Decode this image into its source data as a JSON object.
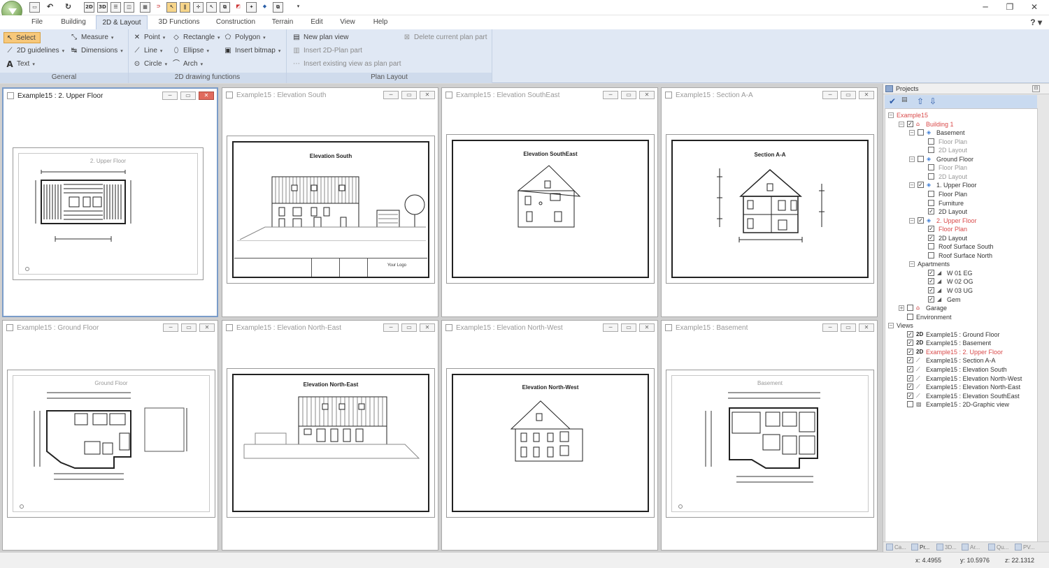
{
  "titlebar": {
    "quick_access": [
      "new-doc-icon",
      "undo-icon",
      "redo-icon",
      "view-2d-icon",
      "view-3d-icon",
      "split-horizontal-icon",
      "split-vertical-icon",
      "grid-icon",
      "magnet-icon",
      "cursor-select-icon",
      "parallel-icon",
      "snap-icon",
      "pointer-icon",
      "maximize-views-icon",
      "export-icon",
      "render-icon",
      "brush-icon",
      "copy-icon"
    ],
    "qat_labels": {
      "view_2d": "2D",
      "view_3d": "3D"
    },
    "window_controls": {
      "minimize": "─",
      "restore": "❐",
      "close": "✕"
    }
  },
  "menu": {
    "items": [
      "File",
      "Building",
      "2D & Layout",
      "3D Functions",
      "Construction",
      "Terrain",
      "Edit",
      "View",
      "Help"
    ],
    "active": "2D & Layout",
    "help": "?"
  },
  "ribbon": {
    "general": {
      "label": "General",
      "select": "Select",
      "measure": "Measure",
      "guidelines": "2D guidelines",
      "dimensions": "Dimensions",
      "text": "Text"
    },
    "drawing": {
      "label": "2D drawing functions",
      "point": "Point",
      "rectangle": "Rectangle",
      "polygon": "Polygon",
      "line": "Line",
      "ellipse": "Ellipse",
      "insert_bitmap": "Insert bitmap",
      "circle": "Circle",
      "arch": "Arch"
    },
    "layout": {
      "label": "Plan Layout",
      "new_plan_view": "New plan view",
      "delete_plan_part": "Delete current plan part",
      "insert_2d": "Insert 2D-Plan part",
      "insert_existing": "Insert existing view as plan part"
    }
  },
  "views": [
    {
      "title": "Example15 : 2. Upper Floor",
      "drawing_title": "2. Upper Floor",
      "active": true
    },
    {
      "title": "Example15 : Elevation South",
      "drawing_title": "Elevation South",
      "title_block": "Your Logo"
    },
    {
      "title": "Example15 : Elevation SouthEast",
      "drawing_title": "Elevation SouthEast"
    },
    {
      "title": "Example15 : Section A-A",
      "drawing_title": "Section A-A"
    },
    {
      "title": "Example15 : Ground Floor",
      "drawing_title": "Ground Floor"
    },
    {
      "title": "Example15 : Elevation North-East",
      "drawing_title": "Elevation North-East"
    },
    {
      "title": "Example15 : Elevation North-West",
      "drawing_title": "Elevation North-West"
    },
    {
      "title": "Example15 : Basement",
      "drawing_title": "Basement"
    }
  ],
  "projects": {
    "title": "Projects",
    "tree": [
      {
        "label": "Example15",
        "level": 0,
        "state": "open",
        "color": "red"
      },
      {
        "label": "Building 1",
        "level": 1,
        "state": "open",
        "checked": true,
        "color": "red",
        "icon": "building-icon"
      },
      {
        "label": "Basement",
        "level": 2,
        "state": "open",
        "checked": false,
        "icon": "floor-icon"
      },
      {
        "label": "Floor Plan",
        "level": 3,
        "checked": false,
        "color": "grey"
      },
      {
        "label": "2D Layout",
        "level": 3,
        "checked": false,
        "color": "grey"
      },
      {
        "label": "Ground Floor",
        "level": 2,
        "state": "open",
        "checked": false,
        "icon": "floor-icon"
      },
      {
        "label": "Floor Plan",
        "level": 3,
        "checked": false,
        "color": "grey"
      },
      {
        "label": "2D Layout",
        "level": 3,
        "checked": false,
        "color": "grey"
      },
      {
        "label": "1. Upper Floor",
        "level": 2,
        "state": "open",
        "checked": true,
        "icon": "floor-icon"
      },
      {
        "label": "Floor Plan",
        "level": 3,
        "checked": false
      },
      {
        "label": "Furniture",
        "level": 3,
        "checked": false
      },
      {
        "label": "2D Layout",
        "level": 3,
        "checked": true
      },
      {
        "label": "2. Upper Floor",
        "level": 2,
        "state": "open",
        "checked": true,
        "color": "red",
        "icon": "floor-icon"
      },
      {
        "label": "Floor Plan",
        "level": 3,
        "checked": true,
        "color": "red"
      },
      {
        "label": "2D Layout",
        "level": 3,
        "checked": true
      },
      {
        "label": "Roof Surface South",
        "level": 3,
        "checked": false
      },
      {
        "label": "Roof Surface North",
        "level": 3,
        "checked": false
      },
      {
        "label": "Apartments",
        "level": 2,
        "state": "open"
      },
      {
        "label": "W 01 EG",
        "level": 3,
        "checked": true,
        "icon": "apartment-icon"
      },
      {
        "label": "W 02 OG",
        "level": 3,
        "checked": true,
        "icon": "apartment-icon"
      },
      {
        "label": "W 03 UG",
        "level": 3,
        "checked": true,
        "icon": "apartment-icon"
      },
      {
        "label": "Gem",
        "level": 3,
        "checked": true,
        "icon": "apartment-icon"
      },
      {
        "label": "Garage",
        "level": 1,
        "state": "closed",
        "checked": false,
        "icon": "building-icon"
      },
      {
        "label": "Environment",
        "level": 1,
        "checked": false
      },
      {
        "label": "Views",
        "level": 0,
        "state": "open"
      },
      {
        "label": "Example15 : Ground Floor",
        "level": 1,
        "checked": true,
        "tag": "2D"
      },
      {
        "label": "Example15 : Basement",
        "level": 1,
        "checked": true,
        "tag": "2D"
      },
      {
        "label": "Example15 : 2. Upper Floor",
        "level": 1,
        "checked": true,
        "tag": "2D",
        "color": "red"
      },
      {
        "label": "Example15 : Section A-A",
        "level": 1,
        "checked": true,
        "icon": "view-icon"
      },
      {
        "label": "Example15 : Elevation South",
        "level": 1,
        "checked": true,
        "icon": "view-icon"
      },
      {
        "label": "Example15 : Elevation North-West",
        "level": 1,
        "checked": true,
        "icon": "view-icon"
      },
      {
        "label": "Example15 : Elevation North-East",
        "level": 1,
        "checked": true,
        "icon": "view-icon"
      },
      {
        "label": "Example15 : Elevation SouthEast",
        "level": 1,
        "checked": true,
        "icon": "view-icon"
      },
      {
        "label": "Example15 : 2D-Graphic view",
        "level": 1,
        "checked": false,
        "icon": "graphic-view-icon"
      }
    ],
    "tabs": [
      "Ca...",
      "Pr...",
      "3D...",
      "Ar...",
      "Qu...",
      "PV..."
    ]
  },
  "status": {
    "x": "x: 4.4955",
    "y": "y: 10.5976",
    "z": "z: 22.1312"
  },
  "colors": {
    "ribbon_bg": "#e0e8f4",
    "accent_red": "#d94a4a",
    "select_highlight": "#f7c87a"
  }
}
